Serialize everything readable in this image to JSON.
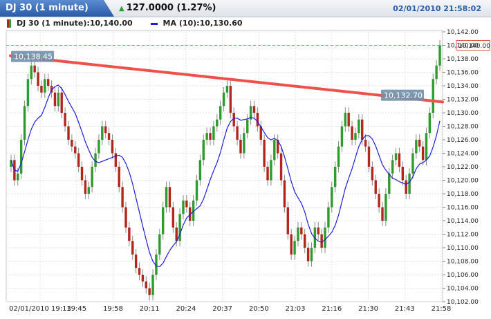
{
  "header": {
    "tab_title": "DJ 30 (1 minute)",
    "price": "127.0000 (1.27%)",
    "datetime": "02/01/2010 21:58:02"
  },
  "legend": {
    "series_label": "DJ 30 (1 minute):10,140.00",
    "ma_label": "MA (10):10,130.60"
  },
  "colors": {
    "up": "#2e9b2e",
    "down": "#b3261e",
    "ma": "#1c1cd6",
    "trendline": "#f0504a",
    "accent": "#2a5ba8"
  },
  "chart_data": {
    "type": "candlestick",
    "title": "DJ 30 (1 minute)",
    "ylim": [
      10102,
      10142
    ],
    "y_ticks": [
      "10,102.00",
      "10,104.00",
      "10,106.00",
      "10,108.00",
      "10,110.00",
      "10,112.00",
      "10,114.00",
      "10,116.00",
      "10,118.00",
      "10,120.00",
      "10,122.00",
      "10,124.00",
      "10,126.00",
      "10,128.00",
      "10,130.00",
      "10,132.00",
      "10,134.00",
      "10,136.00",
      "10,138.00",
      "10,140.00",
      "10,142.00"
    ],
    "x_ticks": [
      "02/01/2010 19:13",
      "19:45",
      "19:58",
      "20:11",
      "20:24",
      "20:37",
      "20:50",
      "21:03",
      "21:16",
      "21:30",
      "21:43",
      "21:58"
    ],
    "last_price_label": "10,140.00",
    "last_price": 10140,
    "closes": [
      10123,
      10120,
      10121,
      10126,
      10131,
      10135,
      10137,
      10136,
      10134,
      10133,
      10135,
      10134,
      10133,
      10131,
      10133,
      10130,
      10128,
      10126,
      10125,
      10124,
      10122,
      10120,
      10118,
      10119,
      10122,
      10124,
      10126,
      10128,
      10127,
      10126,
      10124,
      10122,
      10119,
      10116,
      10113,
      10111,
      10109,
      10107,
      10106,
      10105,
      10104,
      10103,
      10106,
      10109,
      10112,
      10116,
      10119,
      10116,
      10113,
      10111,
      10115,
      10117,
      10116,
      10114,
      10117,
      10120,
      10123,
      10126,
      10127,
      10126,
      10128,
      10129,
      10131,
      10133,
      10134,
      10130,
      10128,
      10126,
      10124,
      10127,
      10129,
      10131,
      10130,
      10128,
      10126,
      10122,
      10120,
      10123,
      10126,
      10124,
      10120,
      10116,
      10112,
      10109,
      10111,
      10113,
      10112,
      10110,
      10108,
      10110,
      10113,
      10112,
      10110,
      10113,
      10116,
      10119,
      10122,
      10125,
      10128,
      10130,
      10128,
      10126,
      10127,
      10129,
      10126,
      10125,
      10122,
      10120,
      10118,
      10116,
      10114,
      10118,
      10121,
      10123,
      10124,
      10122,
      10120,
      10118,
      10121,
      10124,
      10126,
      10125,
      10123,
      10127,
      10130,
      10135,
      10137,
      10140
    ],
    "ma_period": 10,
    "annotations": [
      {
        "label": "10,138.45",
        "value": 10138.45
      },
      {
        "label": "10,132.70",
        "value": 10132.7
      }
    ],
    "trendline": {
      "start": 10138.45,
      "end": 10131.6
    }
  }
}
